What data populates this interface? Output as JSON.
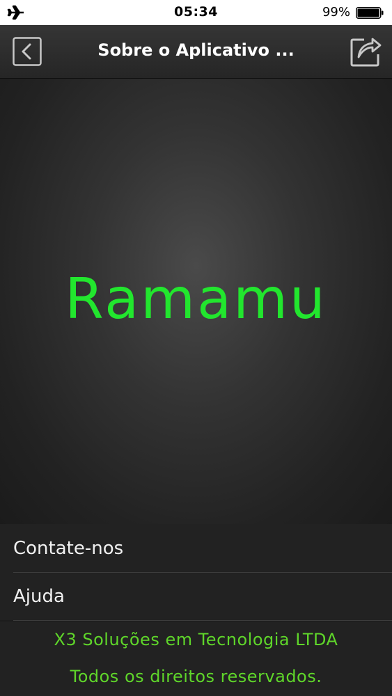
{
  "status_bar": {
    "airplane_icon": "airplane-icon",
    "time": "05:34",
    "battery_percent": "99%",
    "battery_level": 0.99
  },
  "nav": {
    "title": "Sobre o Aplicativo ...",
    "back_icon": "chevron-left-icon",
    "share_icon": "share-icon"
  },
  "banner": {
    "app_name": "Ramamu",
    "app_name_color": "#22e62e"
  },
  "menu": {
    "items": [
      {
        "label": "Contate-nos"
      },
      {
        "label": "Ajuda"
      }
    ]
  },
  "footer": {
    "company": "X3 Soluções em Tecnologia LTDA",
    "rights": "Todos os direitos reservados.",
    "text_color": "#5fd62a"
  }
}
